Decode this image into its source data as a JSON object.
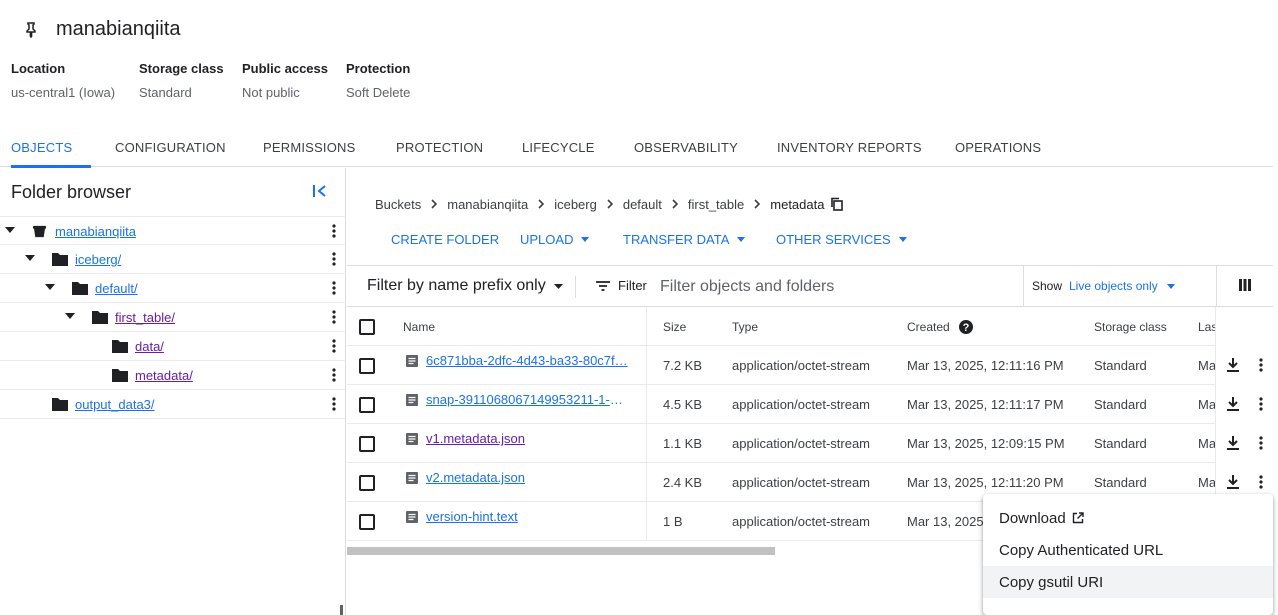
{
  "bucket": {
    "name": "manabianqiita"
  },
  "overview": [
    {
      "label": "Location",
      "value": "us-central1 (Iowa)"
    },
    {
      "label": "Storage class",
      "value": "Standard"
    },
    {
      "label": "Public access",
      "value": "Not public"
    },
    {
      "label": "Protection",
      "value": "Soft Delete"
    }
  ],
  "tabs": [
    "OBJECTS",
    "CONFIGURATION",
    "PERMISSIONS",
    "PROTECTION",
    "LIFECYCLE",
    "OBSERVABILITY",
    "INVENTORY REPORTS",
    "OPERATIONS"
  ],
  "active_tab": "OBJECTS",
  "folder_browser": {
    "title": "Folder browser",
    "items": [
      {
        "label": "manabianqiita"
      },
      {
        "label": "iceberg/"
      },
      {
        "label": "default/"
      },
      {
        "label": "first_table/"
      },
      {
        "label": "data/"
      },
      {
        "label": "metadata/"
      },
      {
        "label": "output_data3/"
      }
    ]
  },
  "breadcrumb": [
    "Buckets",
    "manabianqiita",
    "iceberg",
    "default",
    "first_table",
    "metadata"
  ],
  "actions": {
    "create_folder": "CREATE FOLDER",
    "upload": "UPLOAD",
    "transfer_data": "TRANSFER DATA",
    "other_services": "OTHER SERVICES"
  },
  "filter": {
    "prefix_mode": "Filter by name prefix only",
    "filter_label": "Filter",
    "placeholder": "Filter objects and folders",
    "show_label": "Show",
    "show_value": "Live objects only"
  },
  "table": {
    "columns": {
      "name": "Name",
      "size": "Size",
      "type": "Type",
      "created": "Created",
      "storage_class": "Storage class",
      "last": "Las"
    },
    "rows": [
      {
        "name": "6c871bba-2dfc-4d43-ba33-80c7f…",
        "size": "7.2 KB",
        "type": "application/octet-stream",
        "created": "Mar 13, 2025, 12:11:16 PM",
        "storage_class": "Standard",
        "last": "Ma"
      },
      {
        "name": "snap-3911068067149953211-1-6…",
        "size": "4.5 KB",
        "type": "application/octet-stream",
        "created": "Mar 13, 2025, 12:11:17 PM",
        "storage_class": "Standard",
        "last": "Ma"
      },
      {
        "name": "v1.metadata.json",
        "size": "1.1 KB",
        "type": "application/octet-stream",
        "created": "Mar 13, 2025, 12:09:15 PM",
        "storage_class": "Standard",
        "last": "Ma"
      },
      {
        "name": "v2.metadata.json",
        "size": "2.4 KB",
        "type": "application/octet-stream",
        "created": "Mar 13, 2025, 12:11:20 PM",
        "storage_class": "Standard",
        "last": "Ma"
      },
      {
        "name": "version-hint.text",
        "size": "1 B",
        "type": "application/octet-stream",
        "created": "Mar 13, 2025",
        "storage_class": "",
        "last": ""
      }
    ]
  },
  "context_menu": {
    "items": [
      "Download",
      "Copy Authenticated URL",
      "Copy gsutil URI"
    ],
    "hovered": "Copy gsutil URI"
  },
  "colors": {
    "accent": "#1a73e8",
    "visited_link": "#681da8"
  },
  "icons": [
    "pin-icon",
    "collapse-panel-icon",
    "bucket-icon",
    "folder-icon",
    "more-vert-icon",
    "chevron-right-icon",
    "copy-icon",
    "filter-list-icon",
    "view-columns-icon",
    "help-icon",
    "file-icon",
    "download-icon",
    "open-in-new-icon",
    "caret-down-icon"
  ]
}
